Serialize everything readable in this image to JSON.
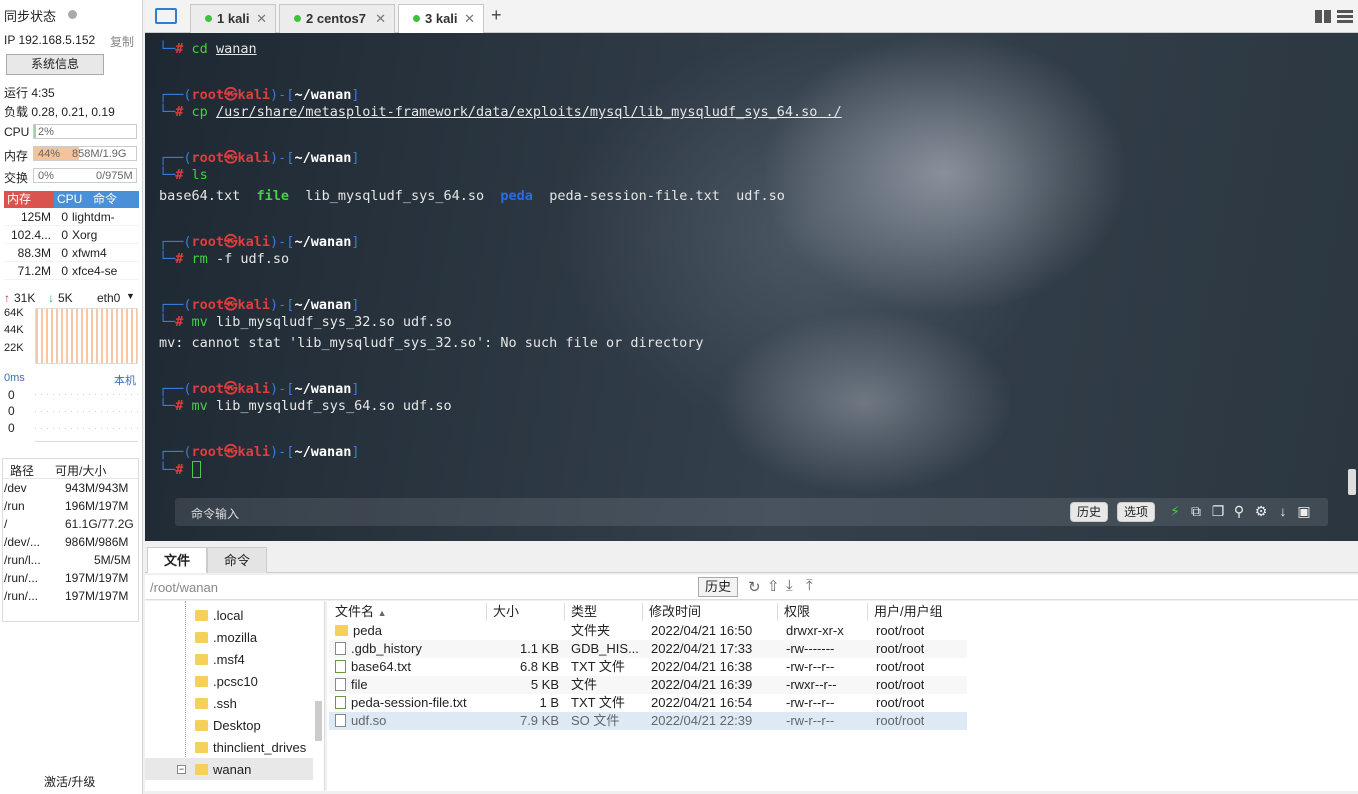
{
  "left_panel": {
    "sync_status": "同步状态",
    "ip_label": "IP 192.168.5.152",
    "copy_label": "复制",
    "sysinfo_button": "系统信息",
    "uptime": "运行 4:35",
    "load": "负载 0.28, 0.21, 0.19",
    "cpu_label": "CPU",
    "cpu_value": "2%",
    "cpu_fraction": 0.02,
    "mem_label": "内存",
    "mem_percent": "44%",
    "mem_value": "858M/1.9G",
    "mem_fraction": 0.44,
    "swap_label": "交换",
    "swap_percent": "0%",
    "swap_value": "0/975M",
    "process_headers": [
      "内存",
      "CPU",
      "命令"
    ],
    "processes": [
      {
        "mem": "125M",
        "cpu": "0",
        "cmd": "lightdm-"
      },
      {
        "mem": "102.4...",
        "cpu": "0",
        "cmd": "Xorg"
      },
      {
        "mem": "88.3M",
        "cpu": "0",
        "cmd": "xfwm4"
      },
      {
        "mem": "71.2M",
        "cpu": "0",
        "cmd": "xfce4-se"
      }
    ],
    "net_up": "31K",
    "net_down": "5K",
    "net_iface": "eth0",
    "net_scale": [
      "64K",
      "44K",
      "22K"
    ],
    "ping_label": "0ms",
    "ping_host": "本机",
    "ping_values": [
      "0",
      "0",
      "0"
    ],
    "disk_headers": [
      "路径",
      "可用/大小"
    ],
    "disks": [
      {
        "path": "/dev",
        "size": "943M/943M"
      },
      {
        "path": "/run",
        "size": "196M/197M"
      },
      {
        "path": "/",
        "size": "61.1G/77.2G"
      },
      {
        "path": "/dev/...",
        "size": "986M/986M"
      },
      {
        "path": "/run/l...",
        "size": "5M/5M"
      },
      {
        "path": "/run/...",
        "size": "197M/197M"
      },
      {
        "path": "/run/...",
        "size": "197M/197M"
      }
    ],
    "activate": "激活/升级"
  },
  "tabs": [
    {
      "label": "1 kali"
    },
    {
      "label": "2 centos7"
    },
    {
      "label": "3 kali"
    }
  ],
  "terminal": {
    "host": "kali",
    "user": "root",
    "cwd": "~/wanan",
    "lines": [
      {
        "type": "cmd",
        "cmd": "cd",
        "arg": "wanan"
      },
      {
        "type": "cmd",
        "cmd": "cp",
        "arg": "/usr/share/metasploit-framework/data/exploits/mysql/lib_mysqludf_sys_64.so ./"
      },
      {
        "type": "cmd",
        "cmd": "ls",
        "arg": ""
      },
      {
        "type": "cmd",
        "cmd": "rm",
        "arg": "-f udf.so"
      },
      {
        "type": "cmd",
        "cmd": "mv",
        "arg": "lib_mysqludf_sys_32.so udf.so"
      },
      {
        "type": "cmd",
        "cmd": "mv",
        "arg": "lib_mysqludf_sys_64.so udf.so"
      }
    ],
    "ls_output": [
      "base64.txt",
      "file",
      "lib_mysqludf_sys_64.so",
      "peda",
      "peda-session-file.txt",
      "udf.so"
    ],
    "error_line": "mv: cannot stat 'lib_mysqludf_sys_32.so': No such file or directory",
    "command_input_placeholder": "命令输入",
    "history_button": "历史",
    "options_button": "选项"
  },
  "bottom_tabs": [
    "文件",
    "命令"
  ],
  "path_value": "/root/wanan",
  "history_button": "历史",
  "tree": [
    ".local",
    ".mozilla",
    ".msf4",
    ".pcsc10",
    ".ssh",
    "Desktop",
    "thinclient_drives",
    "wanan"
  ],
  "file_headers": [
    "文件名",
    "大小",
    "类型",
    "修改时间",
    "权限",
    "用户/用户组"
  ],
  "files": [
    {
      "name": "peda",
      "size": "",
      "type": "文件夹",
      "mtime": "2022/04/21 16:50",
      "perm": "drwxr-xr-x",
      "owner": "root/root"
    },
    {
      "name": ".gdb_history",
      "size": "1.1 KB",
      "type": "GDB_HIS...",
      "mtime": "2022/04/21 17:33",
      "perm": "-rw-------",
      "owner": "root/root"
    },
    {
      "name": "base64.txt",
      "size": "6.8 KB",
      "type": "TXT 文件",
      "mtime": "2022/04/21 16:38",
      "perm": "-rw-r--r--",
      "owner": "root/root"
    },
    {
      "name": "file",
      "size": "5 KB",
      "type": "文件",
      "mtime": "2022/04/21 16:39",
      "perm": "-rwxr--r--",
      "owner": "root/root"
    },
    {
      "name": "peda-session-file.txt",
      "size": "1 B",
      "type": "TXT 文件",
      "mtime": "2022/04/21 16:54",
      "perm": "-rw-r--r--",
      "owner": "root/root"
    },
    {
      "name": "udf.so",
      "size": "7.9 KB",
      "type": "SO 文件",
      "mtime": "2022/04/21 22:39",
      "perm": "-rw-r--r--",
      "owner": "root/root"
    }
  ],
  "colors": {
    "accent_blue": "#3a7bd5",
    "prompt_red": "#e03d3d",
    "mem_orange": "#f5c39a",
    "proc_header_red": "#d9534f",
    "proc_header_blue": "#4a90d9"
  }
}
